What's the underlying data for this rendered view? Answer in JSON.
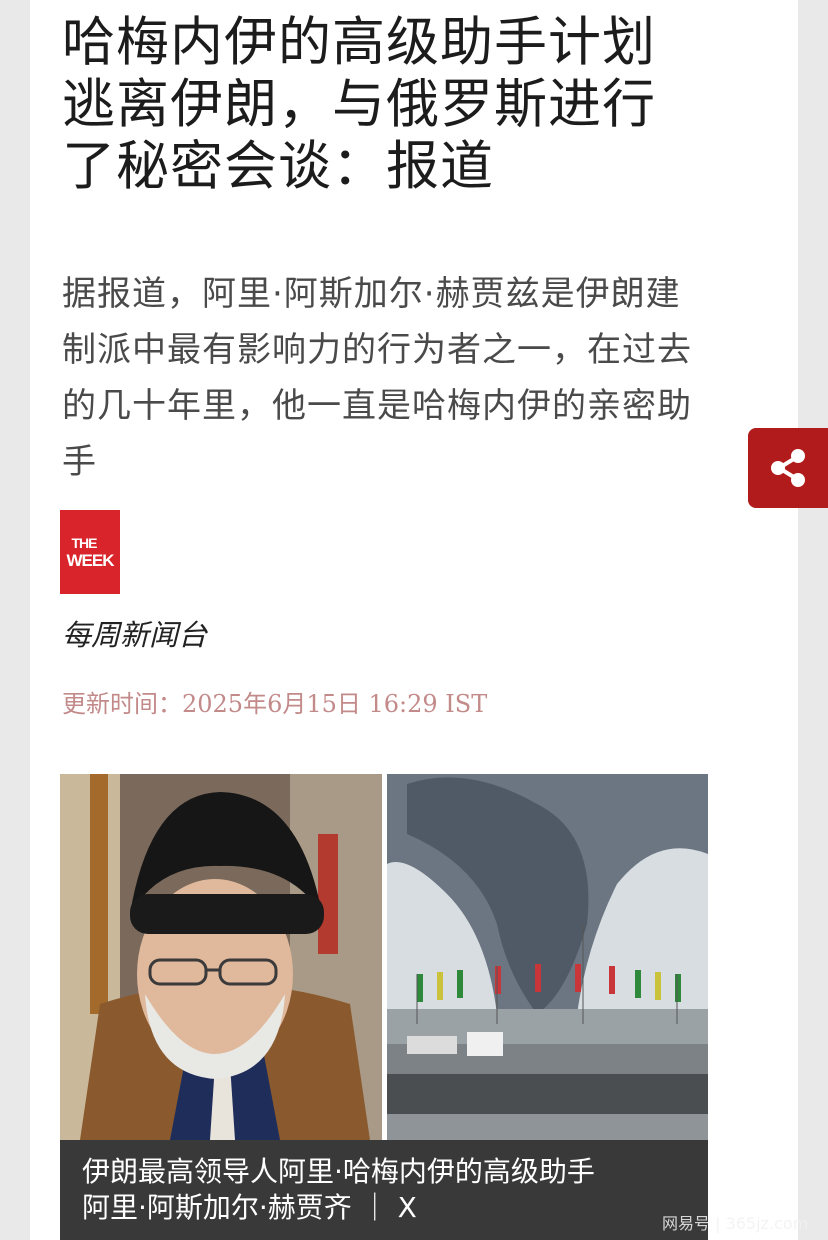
{
  "article": {
    "headline_line1": "哈梅内伊的高级助手计划",
    "headline_line2": "逃离伊朗，与俄罗斯进行",
    "headline_line3": "了秘密会谈：报道",
    "summary_line1": "据报道，阿里·阿斯加尔·赫贾兹是伊朗建",
    "summary_line2": "制派中最有影响力的行为者之一，在过去",
    "summary_line3": "的几十年里，他一直是哈梅内伊的亲密助",
    "summary_line4": "手",
    "source_logo_text_top": "THE",
    "source_logo_text_bottom": "WEEK",
    "source_name": "每周新闻台",
    "updated": "更新时间：2025年6月15日 16:29 IST",
    "caption_line1": "伊朗最高领导人阿里·哈梅内伊的高级助手",
    "caption_line2": "阿里·阿斯加尔·赫贾齐 ｜ X"
  },
  "watermark": "网易号 | 365jz.com",
  "icons": {
    "share": "share-icon"
  },
  "colors": {
    "share_bg": "#b11b1b",
    "logo_bg": "#d8242a",
    "updated_text": "#c38a8a"
  }
}
